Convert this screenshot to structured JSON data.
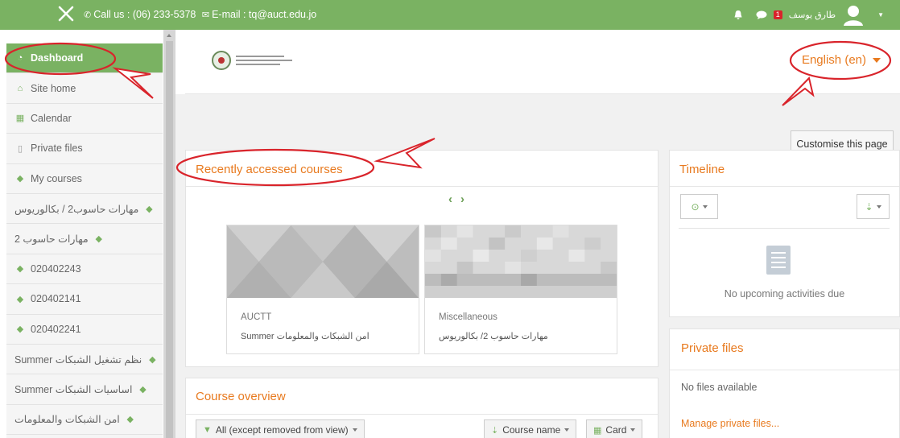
{
  "topbar": {
    "contact": "Call us : (06) 233-5378",
    "email": "E-mail : tq@auct.edu.jo",
    "notifications_count": "1",
    "user_name": "طارق يوسف"
  },
  "sidebar": {
    "items": [
      {
        "label": "Dashboard",
        "icon": "dashboard-icon"
      },
      {
        "label": "Site home",
        "icon": "home-icon"
      },
      {
        "label": "Calendar",
        "icon": "calendar-icon"
      },
      {
        "label": "Private files",
        "icon": "file-icon"
      },
      {
        "label": "My courses",
        "icon": "graduation-cap-icon"
      },
      {
        "label": "مهارات حاسوب2 / بكالوريوس",
        "icon": "graduation-cap-icon"
      },
      {
        "label": "مهارات حاسوب 2",
        "icon": "graduation-cap-icon"
      },
      {
        "label": "020402243",
        "icon": "graduation-cap-icon"
      },
      {
        "label": "020402141",
        "icon": "graduation-cap-icon"
      },
      {
        "label": "020402241",
        "icon": "graduation-cap-icon"
      },
      {
        "label": "Summer نظم تشغيل الشبكات",
        "icon": "graduation-cap-icon"
      },
      {
        "label": "Summer اساسيات الشبكات",
        "icon": "graduation-cap-icon"
      },
      {
        "label": "امن الشبكات والمعلومات",
        "icon": "graduation-cap-icon"
      }
    ]
  },
  "header": {
    "language": "English ‎(en)‎"
  },
  "customise_button": "Customise this page",
  "recent": {
    "title": "Recently accessed courses",
    "courses": [
      {
        "category": "AUCTT",
        "name": "Summer امن الشبكات والمعلومات"
      },
      {
        "category": "Miscellaneous",
        "name": "مهارات حاسوب 2/ بكالوريوس"
      }
    ]
  },
  "overview": {
    "title": "Course overview",
    "filter": "All (except removed from view)",
    "sort": "Course name",
    "view": "Card"
  },
  "timeline": {
    "title": "Timeline",
    "empty": "No upcoming activities due"
  },
  "private_files": {
    "title": "Private files",
    "empty": "No files available",
    "manage": "Manage private files..."
  },
  "colors": {
    "brand_green": "#7ab262",
    "accent_orange": "#e87a1f",
    "annotation_red": "#d9242b"
  }
}
